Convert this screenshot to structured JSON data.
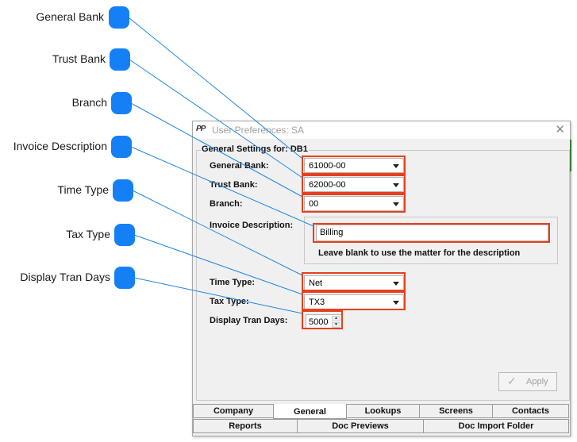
{
  "callouts": [
    {
      "label": "General Bank"
    },
    {
      "label": "Trust Bank"
    },
    {
      "label": "Branch"
    },
    {
      "label": "Invoice Description"
    },
    {
      "label": "Time Type"
    },
    {
      "label": "Tax Type"
    },
    {
      "label": "Display Tran Days"
    }
  ],
  "window": {
    "title": "User Preferences: SA",
    "icon": "app-logo-icon",
    "close": "✕"
  },
  "group": {
    "title": "General Settings for: DB1"
  },
  "fields": {
    "general_bank": {
      "label": "General Bank:",
      "value": "61000-00"
    },
    "trust_bank": {
      "label": "Trust Bank:",
      "value": "62000-00"
    },
    "branch": {
      "label": "Branch:",
      "value": "00"
    },
    "invoice_description": {
      "label": "Invoice Description:",
      "value": "Billing",
      "hint": "Leave blank to use the matter for the description"
    },
    "time_type": {
      "label": "Time Type:",
      "value": "Net"
    },
    "tax_type": {
      "label": "Tax Type:",
      "value": "TX3"
    },
    "display_tran_days": {
      "label": "Display Tran Days:",
      "value": "5000"
    }
  },
  "apply_label": "Apply",
  "tabs_row1": [
    {
      "label": "Company"
    },
    {
      "label": "General"
    },
    {
      "label": "Lookups"
    },
    {
      "label": "Screens"
    },
    {
      "label": "Contacts"
    }
  ],
  "tabs_row2": [
    {
      "label": "Reports"
    },
    {
      "label": "Doc Previews"
    },
    {
      "label": "Doc Import Folder"
    }
  ],
  "colors": {
    "callout": "#1580f5",
    "leader": "#1d86e6",
    "highlight": "#e8401c"
  }
}
